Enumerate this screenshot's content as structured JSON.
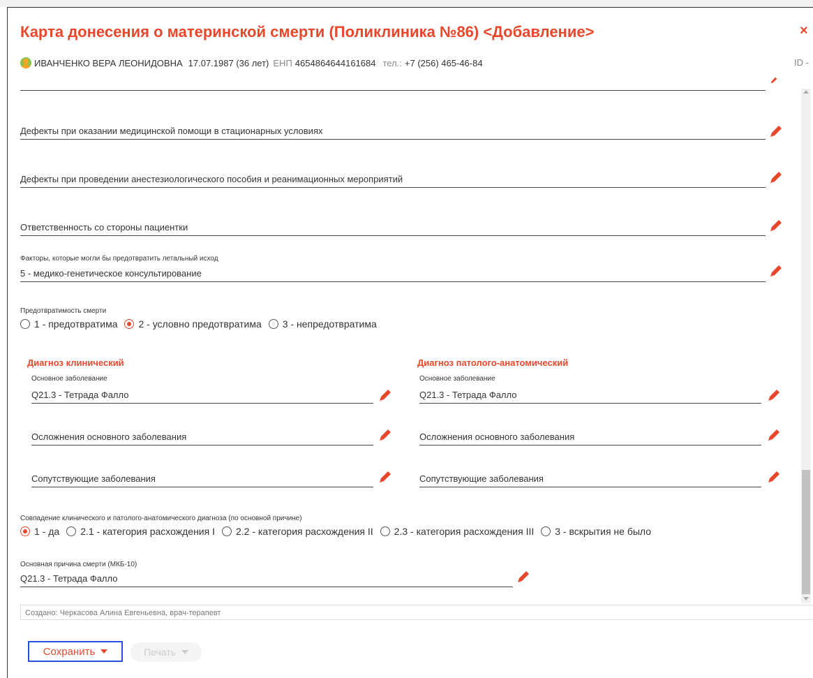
{
  "dialog": {
    "title": "Карта донесения о материнской смерти (Поликлиника №86) <Добавление>",
    "close_icon": "×"
  },
  "patient": {
    "name": "ИВАНЧЕНКО ВЕРА ЛЕОНИДОВНА",
    "dob": "17.07.1987 (36 лет)",
    "enp_label": "ЕНП",
    "enp": "4654864644161684",
    "phone_label": "тел.:",
    "phone": "+7 (256) 465-46-84",
    "id_label": "ID -"
  },
  "fields": {
    "defects_hospital": "Дефекты при оказании медицинской помощи в стационарных условиях",
    "defects_anesthesia": "Дефекты при проведении анестезиологического пособия и реанимационных мероприятий",
    "patient_responsibility": "Ответственность со стороны пациентки",
    "prevent_factors_label": "Факторы, которые могли бы предотвратить летальный исход",
    "prevent_factors_value": "5 - медико-генетическое консультирование"
  },
  "preventability": {
    "label": "Предотвратимость смерти",
    "options": [
      "1 - предотвратима",
      "2 - условно предотвратима",
      "3 - непредотвратима"
    ],
    "selected": 1
  },
  "clinical": {
    "heading": "Диагноз клинический",
    "main_label": "Основное заболевание",
    "main_value": "Q21.3 - Тетрада Фалло",
    "complications": "Осложнения основного заболевания",
    "concomitant": "Сопутствующие заболевания"
  },
  "pathology": {
    "heading": "Диагноз патолого-анатомический",
    "main_label": "Основное заболевание",
    "main_value": "Q21.3 - Тетрада Фалло",
    "complications": "Осложнения основного заболевания",
    "concomitant": "Сопутствующие заболевания"
  },
  "match": {
    "label": "Совпадение клинического и патолого-анатомического диагноза (по основной причине)",
    "options": [
      "1 - да",
      "2.1 - категория расхождения I",
      "2.2 - категория расхождения II",
      "2.3 - категория расхождения III",
      "3 - вскрытия не было"
    ],
    "selected": 0
  },
  "cause": {
    "label": "Основная причина смерти (МКБ-10)",
    "value": "Q21.3 - Тетрада Фалло"
  },
  "footer": {
    "created": "Создано: Черкасова Алина Евгеньевна, врач-терапевт",
    "save_label": "Сохранить",
    "print_label": "Печать"
  },
  "colors": {
    "accent": "#e8472c",
    "focus": "#2b4fe0"
  }
}
